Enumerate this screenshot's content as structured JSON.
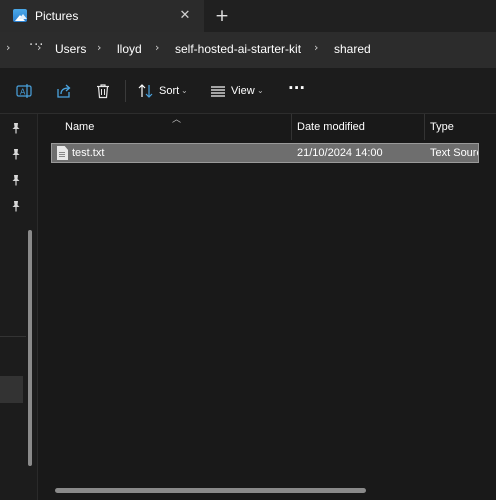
{
  "window": {
    "tab_title": "Pictures",
    "close_glyph": "✕",
    "new_tab_glyph": "+"
  },
  "address": {
    "overflow_glyph": "···",
    "separator": "›",
    "crumbs": [
      "Users",
      "lloyd",
      "self-hosted-ai-starter-kit",
      "shared"
    ]
  },
  "toolbar": {
    "rename_icon": "rename-icon",
    "share_icon": "share-icon",
    "delete_icon": "trash-icon",
    "sort_label": "Sort",
    "view_label": "View",
    "chevron": "⌄",
    "more_glyph": "···"
  },
  "columns": {
    "name": "Name",
    "date_modified": "Date modified",
    "type": "Type",
    "sort_glyph": "︿"
  },
  "files": [
    {
      "name": "test.txt",
      "date_modified": "21/10/2024 14:00",
      "type": "Text Source"
    }
  ],
  "colors": {
    "accent_blue": "#4aa3df",
    "selection": "#6e6e6e",
    "background": "#191919"
  }
}
